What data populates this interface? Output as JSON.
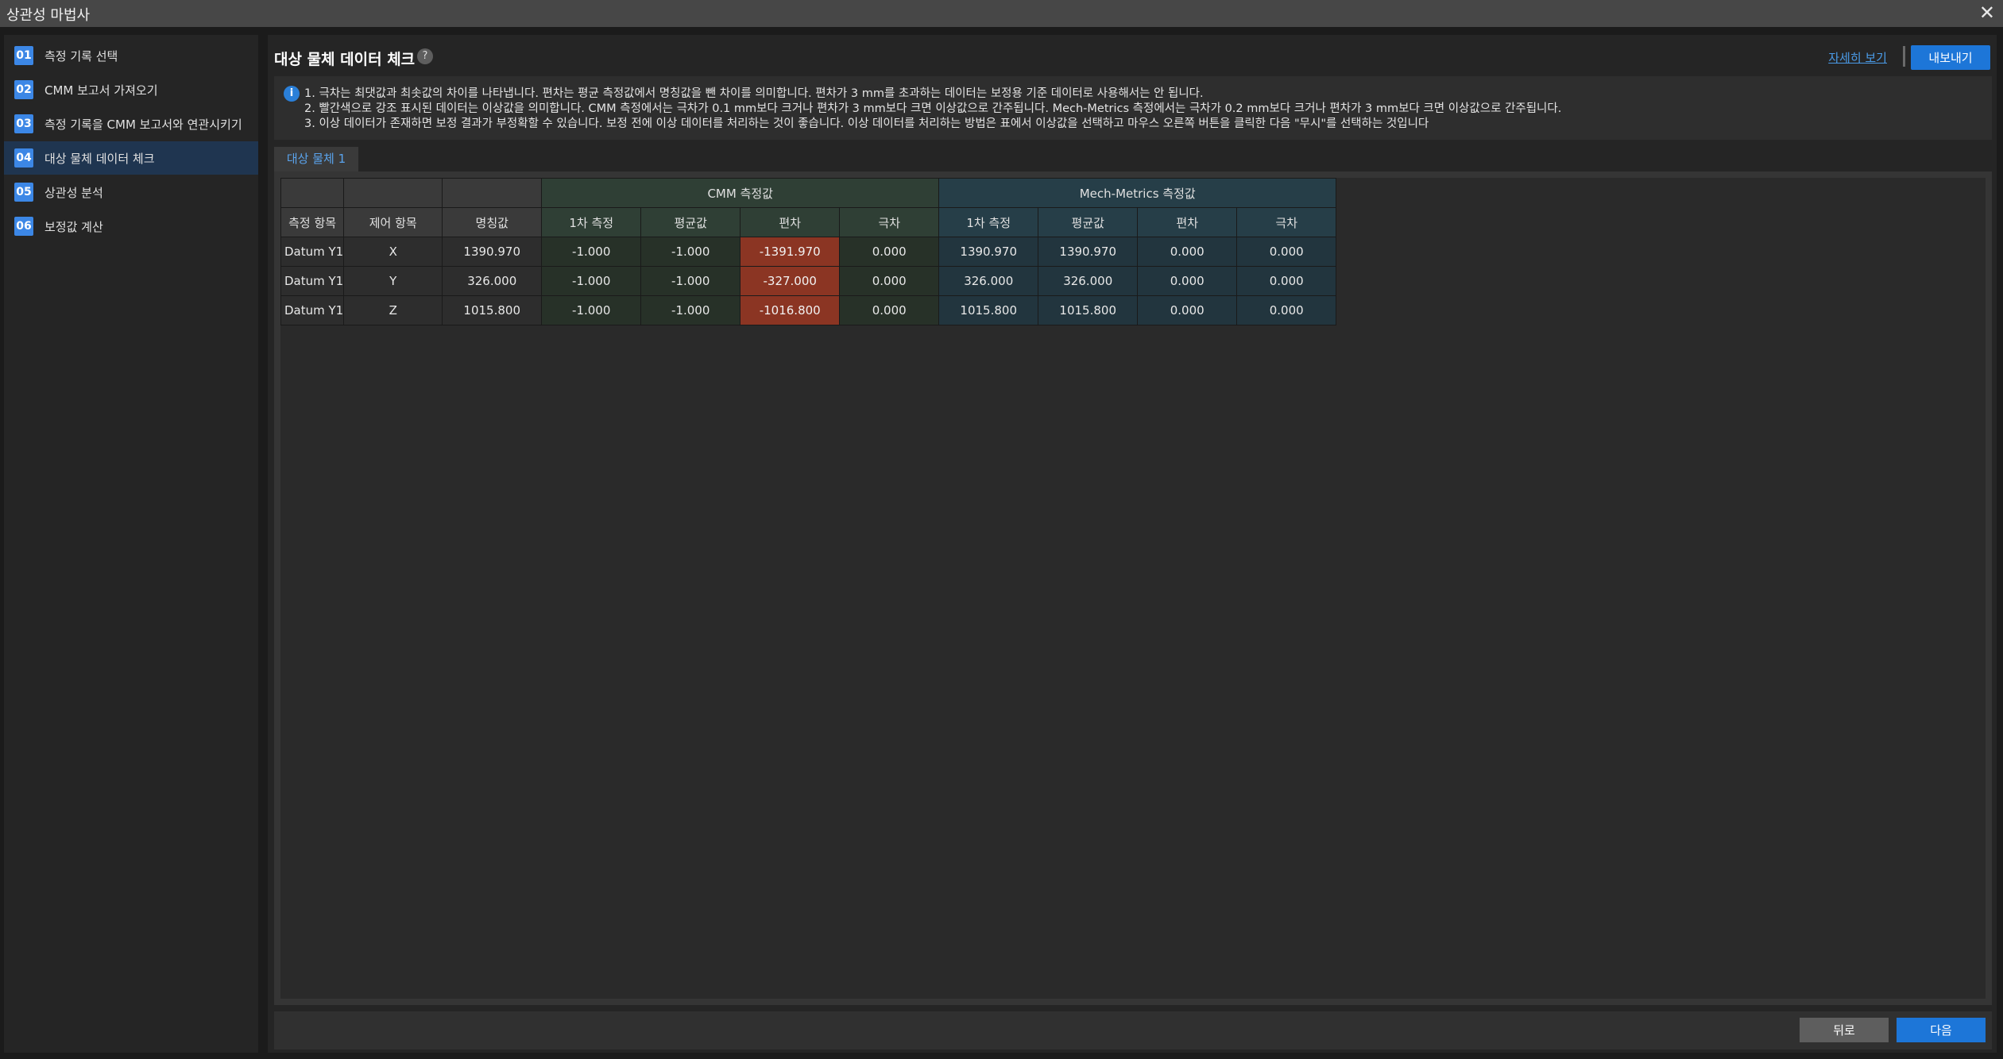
{
  "window": {
    "title": "상관성 마법사",
    "close_glyph": "✕"
  },
  "sidebar": {
    "items": [
      {
        "num": "01",
        "label": "측정 기록 선택",
        "active": false
      },
      {
        "num": "02",
        "label": "CMM 보고서 가져오기",
        "active": false
      },
      {
        "num": "03",
        "label": "측정 기록을 CMM 보고서와 연관시키기",
        "active": false
      },
      {
        "num": "04",
        "label": "대상 물체 데이터 체크",
        "active": true
      },
      {
        "num": "05",
        "label": "상관성 분석",
        "active": false
      },
      {
        "num": "06",
        "label": "보정값 계산",
        "active": false
      }
    ]
  },
  "header": {
    "title": "대상 물체 데이터 체크",
    "help_glyph": "?",
    "detail_link": "자세히 보기",
    "export_label": "내보내기"
  },
  "info": {
    "icon_glyph": "i",
    "lines": [
      "1. 극차는 최댓값과 최솟값의 차이를 나타냅니다. 편차는 평균 측정값에서 명칭값을 뺀 차이를 의미합니다. 편차가 3 mm를 초과하는 데이터는 보정용 기준 데이터로 사용해서는 안 됩니다.",
      "2. 빨간색으로 강조 표시된 데이터는 이상값을 의미합니다. CMM 측정에서는 극차가 0.1 mm보다 크거나 편차가 3 mm보다 크면 이상값으로 간주됩니다. Mech-Metrics 측정에서는 극차가 0.2 mm보다 크거나 편차가 3 mm보다 크면 이상값으로 간주됩니다.",
      "3. 이상 데이터가 존재하면 보정 결과가 부정확할 수 있습니다. 보정 전에 이상 데이터를 처리하는 것이 좋습니다. 이상 데이터를 처리하는 방법은 표에서 이상값을 선택하고 마우스 오른쪽 버튼을 클릭한 다음 \"무시\"를 선택하는 것입니다"
    ]
  },
  "tabs": [
    {
      "label": "대상 물체 1",
      "active": true
    }
  ],
  "table": {
    "group_headers": {
      "cmm": "CMM 측정값",
      "mech": "Mech-Metrics 측정값"
    },
    "columns": [
      "측정 항목",
      "제어 항목",
      "명칭값",
      "1차 측정",
      "평균값",
      "편차",
      "극차",
      "1차 측정",
      "평균값",
      "편차",
      "극차"
    ],
    "rows": [
      {
        "cells": [
          "Datum Y1",
          "X",
          "1390.970",
          "-1.000",
          "-1.000",
          "-1391.970",
          "0.000",
          "1390.970",
          "1390.970",
          "0.000",
          "0.000"
        ],
        "outliers": [
          5
        ]
      },
      {
        "cells": [
          "Datum Y1",
          "Y",
          "326.000",
          "-1.000",
          "-1.000",
          "-327.000",
          "0.000",
          "326.000",
          "326.000",
          "0.000",
          "0.000"
        ],
        "outliers": [
          5
        ]
      },
      {
        "cells": [
          "Datum Y1",
          "Z",
          "1015.800",
          "-1.000",
          "-1.000",
          "-1016.800",
          "0.000",
          "1015.800",
          "1015.800",
          "0.000",
          "0.000"
        ],
        "outliers": [
          5
        ]
      }
    ]
  },
  "footer": {
    "back_label": "뒤로",
    "next_label": "다음"
  },
  "colors": {
    "accent": "#1d76d8",
    "outlier": "#8b3523",
    "cmm_header": "#2f3f35",
    "mech_header": "#263e48"
  }
}
